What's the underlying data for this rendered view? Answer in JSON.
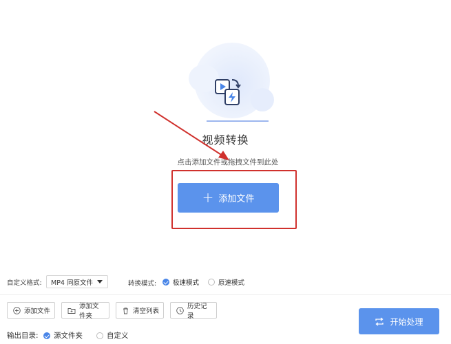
{
  "main": {
    "title": "视频转换",
    "hint": "点击添加文件或拖拽文件到此处",
    "add_file_label": "添加文件"
  },
  "options": {
    "format_label": "自定义格式:",
    "format_value": "MP4 同原文件",
    "mode_label": "转换模式:",
    "modes": [
      {
        "label": "极速模式",
        "selected": true
      },
      {
        "label": "原速模式",
        "selected": false
      }
    ]
  },
  "toolbar": {
    "add_file": "添加文件",
    "add_folder": "添加文件夹",
    "clear_list": "清空列表",
    "history": "历史记录"
  },
  "output": {
    "label": "输出目录:",
    "options": [
      {
        "label": "源文件夹",
        "selected": true
      },
      {
        "label": "自定义",
        "selected": false
      }
    ]
  },
  "start_label": "开始处理",
  "colors": {
    "accent": "#5b93ec",
    "annotation": "#d0312d"
  }
}
